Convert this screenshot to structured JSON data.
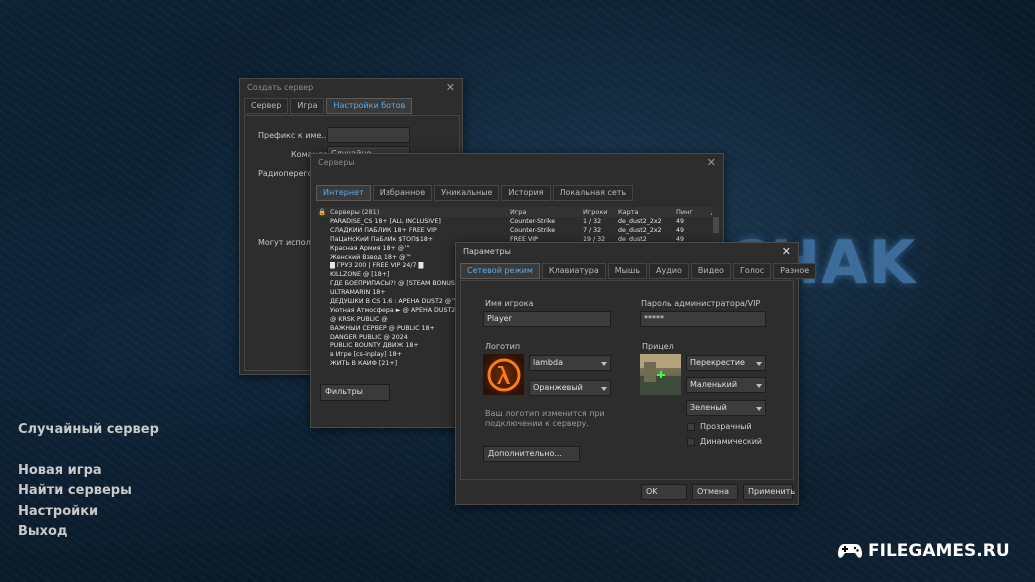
{
  "background": {
    "logo_text": "CHAK",
    "watermark": "FILEGAMES.RU"
  },
  "main_menu": {
    "random_server": "Случайный сервер",
    "new_game": "Новая игра",
    "find_servers": "Найти серверы",
    "settings": "Настройки",
    "exit": "Выход"
  },
  "create_server": {
    "title": "Создать сервер",
    "tabs": [
      "Сервер",
      "Игра",
      "Настройки ботов"
    ],
    "active_tab": 2,
    "prefix_label": "Префикс к име...",
    "team_label": "Команда",
    "team_value": "Случайно",
    "radio_label": "Радиоперегово...",
    "can_use_label": "Могут использ..."
  },
  "servers": {
    "title": "Серверы",
    "tabs": [
      "Интернет",
      "Избранное",
      "Уникальные",
      "История",
      "Локальная сеть"
    ],
    "active_tab": 0,
    "columns": {
      "name": "Серверы (281)",
      "game": "Игра",
      "players": "Игроки",
      "map": "Карта",
      "ping": "Пинг"
    },
    "rows": [
      {
        "name": "PARADISE_CS 18+ [ALL INCLUSIVE]",
        "game": "Counter-Strike",
        "players": "1 / 32",
        "map": "de_dust2_2x2",
        "ping": "49"
      },
      {
        "name": "СЛАДКИЙ ПАБЛИК 18+ FREE VIP",
        "game": "Counter-Strike",
        "players": "7 / 32",
        "map": "de_dust2_2x2",
        "ping": "49"
      },
      {
        "name": "ПаЦаНсКиЙ ПаБлИк $TOП$18+",
        "game": "FREE VIP",
        "players": "19 / 32",
        "map": "de_dust2",
        "ping": "49"
      },
      {
        "name": "Красная Армия 18+ @™",
        "game": "",
        "players": "",
        "map": "",
        "ping": ""
      },
      {
        "name": "Женский Взвод 18+ @™",
        "game": "",
        "players": "",
        "map": "",
        "ping": ""
      },
      {
        "name": "█ ГРУЗ 200 | FREE VIP 24/7 █",
        "game": "",
        "players": "",
        "map": "",
        "ping": ""
      },
      {
        "name": "KILLZONE @ [18+]",
        "game": "",
        "players": "",
        "map": "",
        "ping": ""
      },
      {
        "name": "ГДЕ БОЕПРИПАСЫ?! @ [STEAM BONUS]",
        "game": "",
        "players": "",
        "map": "",
        "ping": ""
      },
      {
        "name": "ULTRAMARIN 18+",
        "game": "",
        "players": "",
        "map": "",
        "ping": ""
      },
      {
        "name": "ДЕДУШКИ В CS 1.6 : АРЕНА DUST2 @™",
        "game": "",
        "players": "",
        "map": "",
        "ping": ""
      },
      {
        "name": "Уютная Атмосфера ► @ АРЕНА DUST2",
        "game": "",
        "players": "",
        "map": "",
        "ping": ""
      },
      {
        "name": "@ KRSK PUBLIC @",
        "game": "",
        "players": "",
        "map": "",
        "ping": ""
      },
      {
        "name": "ВАЖНЫЙ СЕРВЕР @ PUBLIC 18+",
        "game": "",
        "players": "",
        "map": "",
        "ping": ""
      },
      {
        "name": "DANGER PUBLIC @ 2024",
        "game": "",
        "players": "",
        "map": "",
        "ping": ""
      },
      {
        "name": "PUBLIC BOUNTY ДВИЖ 18+",
        "game": "",
        "players": "",
        "map": "",
        "ping": ""
      },
      {
        "name": "в Игре [cs-inplay] 18+",
        "game": "",
        "players": "",
        "map": "",
        "ping": ""
      },
      {
        "name": "ЖИТЬ В КАЙФ [21+]",
        "game": "",
        "players": "",
        "map": "",
        "ping": ""
      }
    ],
    "filters_button": "Фильтры"
  },
  "params": {
    "title": "Параметры",
    "tabs": [
      "Сетевой режим",
      "Клавиатура",
      "Мышь",
      "Аудио",
      "Видео",
      "Голос",
      "Разное"
    ],
    "active_tab": 0,
    "player_name_label": "Имя игрока",
    "player_name_value": "Player",
    "admin_password_label": "Пароль администратора/VIP",
    "admin_password_value": "*****",
    "logo_label": "Логотип",
    "logo_value": "lambda",
    "logo_color_value": "Оранжевый",
    "logo_hint": "Ваш логотип изменится при подключении к серверу.",
    "advanced_button": "Дополнительно...",
    "crosshair_label": "Прицел",
    "crosshair_type": "Перекрестие",
    "crosshair_size": "Маленький",
    "crosshair_color": "Зеленый",
    "transparent_label": "Прозрачный",
    "transparent_checked": false,
    "dynamic_label": "Динамический",
    "dynamic_checked": false,
    "ok_button": "OK",
    "cancel_button": "Отмена",
    "apply_button": "Применить"
  }
}
